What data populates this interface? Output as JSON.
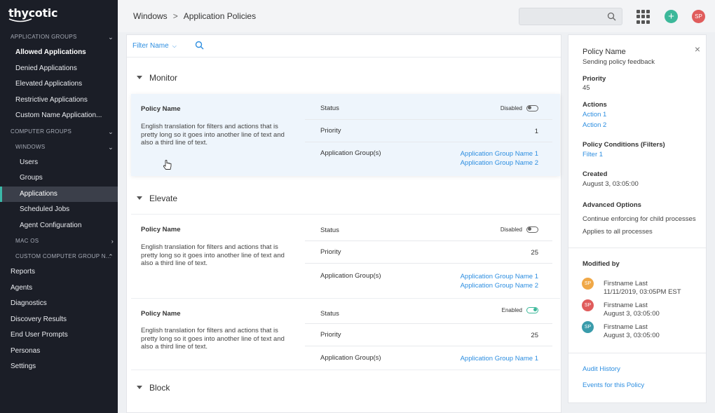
{
  "sidebar": {
    "logo": "thycotic",
    "groups": {
      "application_groups": "APPLICATION GROUPS",
      "computer_groups": "COMPUTER GROUPS",
      "windows": "WINDOWS",
      "mac_os": "MAC OS",
      "custom": "CUSTOM COMPUTER GROUP N..."
    },
    "app_items": [
      "Allowed Applications",
      "Denied Applications",
      "Elevated Applications",
      "Restrictive Applications",
      "Custom Name Application..."
    ],
    "windows_items": [
      "Users",
      "Groups",
      "Applications",
      "Scheduled Jobs",
      "Agent Configuration"
    ],
    "top_items": [
      "Reports",
      "Agents",
      "Diagnostics",
      "Discovery Results",
      "End User Prompts",
      "Personas",
      "Settings"
    ]
  },
  "header": {
    "crumb1": "Windows",
    "crumb_sep": ">",
    "crumb2": "Application Policies",
    "avatar_initials": "SP"
  },
  "filter": {
    "label": "Filter Name"
  },
  "sections": {
    "monitor": "Monitor",
    "elevate": "Elevate",
    "block": "Block"
  },
  "policies": [
    {
      "name_label": "Policy Name",
      "description": "English translation for filters and actions that is pretty long so it goes into another line of text and also a third line of text.",
      "status_label": "Status",
      "status": "Disabled",
      "priority_label": "Priority",
      "priority": "1",
      "groups_label": "Application Group(s)",
      "groups": [
        "Application Group Name 1",
        "Application Group Name 2"
      ]
    },
    {
      "name_label": "Policy Name",
      "description": "English translation for filters and actions that is pretty long so it goes into another line of text and also a third line of text.",
      "status_label": "Status",
      "status": "Disabled",
      "priority_label": "Priority",
      "priority": "25",
      "groups_label": "Application Group(s)",
      "groups": [
        "Application Group Name 1",
        "Application Group Name 2"
      ]
    },
    {
      "name_label": "Policy Name",
      "description": "English translation for filters and actions that is pretty long so it goes into another line of text and also a third line of text.",
      "status_label": "Status",
      "status": "Enabled",
      "priority_label": "Priority",
      "priority": "25",
      "groups_label": "Application Group(s)",
      "groups": [
        "Application Group Name 1"
      ]
    }
  ],
  "details": {
    "policy_name_label": "Policy Name",
    "policy_name": "Sending policy feedback",
    "priority_label": "Priority",
    "priority": "45",
    "actions_label": "Actions",
    "actions": [
      "Action 1",
      "Action 2"
    ],
    "conditions_label": "Policy Conditions (Filters)",
    "conditions": [
      "Filter 1"
    ],
    "created_label": "Created",
    "created": "August 3, 03:05:00",
    "advanced_label": "Advanced Options",
    "advanced": [
      "Continue enforcing for child processes",
      "Applies to all processes"
    ],
    "modified_label": "Modified by",
    "modified": [
      {
        "initials": "SP",
        "name": "Firstname Last",
        "date": "11/11/2019, 03:05PM EST",
        "color": "#f0a847"
      },
      {
        "initials": "SP",
        "name": "Firstname Last",
        "date": "August 3, 03:05:00",
        "color": "#e05c5c"
      },
      {
        "initials": "SP",
        "name": "Firstname Last",
        "date": "August 3, 03:05:00",
        "color": "#3a9cab"
      }
    ],
    "audit_history": "Audit History",
    "events": "Events for this Policy"
  },
  "colors": {
    "accent": "#2d8ee0",
    "active_bar": "#3bb8a8",
    "plus": "#3cb89a",
    "avatar": "#e05c5c"
  },
  "icons": [
    "search-icon",
    "apps-grid-icon",
    "plus-icon",
    "close-icon",
    "chevron-down-icon",
    "toggle-icon",
    "cursor-icon"
  ]
}
